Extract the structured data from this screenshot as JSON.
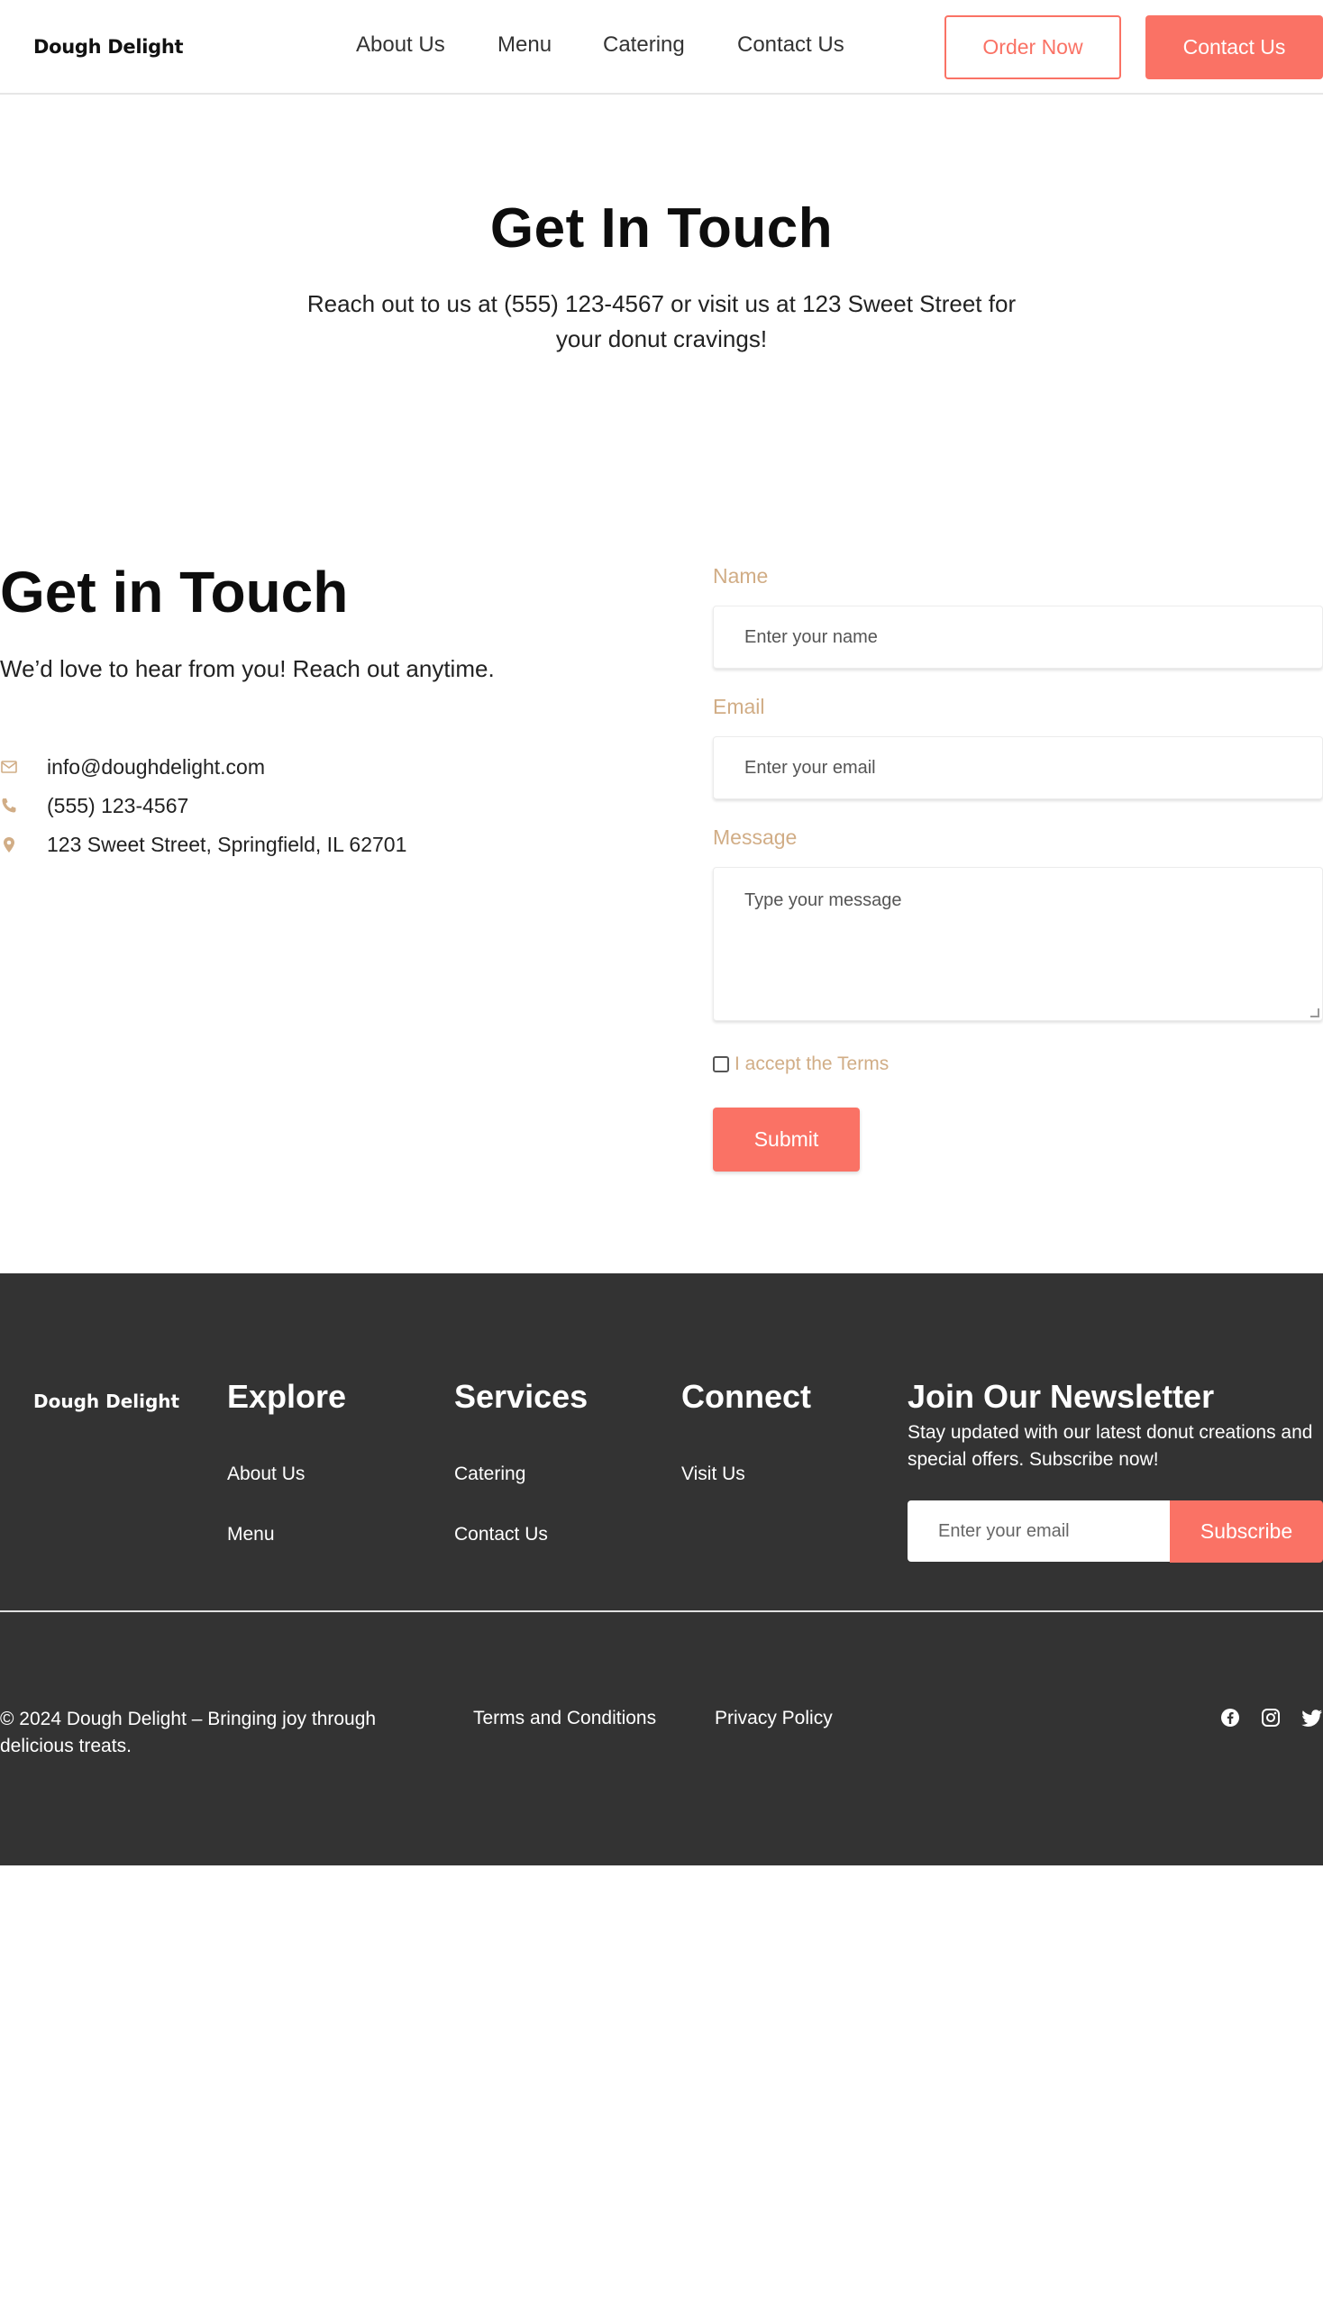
{
  "header": {
    "logo": "Dough Delight",
    "nav": [
      "About Us",
      "Menu",
      "Catering",
      "Contact Us"
    ],
    "order_button": "Order Now",
    "contact_button": "Contact Us"
  },
  "hero": {
    "title": "Get In Touch",
    "text": "Reach out to us at (555) 123-4567 or visit us at 123 Sweet Street for your donut cravings!"
  },
  "contact": {
    "title": "Get in Touch",
    "subtitle": "We’d love to hear from you! Reach out anytime.",
    "email": "info@doughdelight.com",
    "phone": "(555) 123-4567",
    "address": "123 Sweet Street, Springfield, IL 62701",
    "icons": [
      "envelope-icon",
      "phone-icon",
      "map-pin-icon"
    ]
  },
  "form": {
    "name_label": "Name",
    "name_placeholder": "Enter your name",
    "email_label": "Email",
    "email_placeholder": "Enter your email",
    "message_label": "Message",
    "message_placeholder": "Type your message",
    "terms_label": "I accept the Terms",
    "submit_label": "Submit"
  },
  "footer": {
    "logo": "Dough Delight",
    "explore_heading": "Explore",
    "explore_links": [
      "About Us",
      "Menu"
    ],
    "services_heading": "Services",
    "services_links": [
      "Catering",
      "Contact Us"
    ],
    "connect_heading": "Connect",
    "connect_links": [
      "Visit Us"
    ],
    "newsletter_heading": "Join Our Newsletter",
    "newsletter_text": "Stay updated with our latest donut creations and special offers. Subscribe now!",
    "newsletter_placeholder": "Enter your email",
    "subscribe_label": "Subscribe",
    "copyright": "© 2024 Dough Delight – Bringing joy through delicious treats.",
    "terms_link": "Terms and Conditions",
    "privacy_link": "Privacy Policy",
    "social_icons": [
      "facebook-icon",
      "instagram-icon",
      "twitter-icon"
    ]
  },
  "colors": {
    "accent": "#fa7265",
    "label": "#d1ad86",
    "footer_bg": "#333333"
  }
}
